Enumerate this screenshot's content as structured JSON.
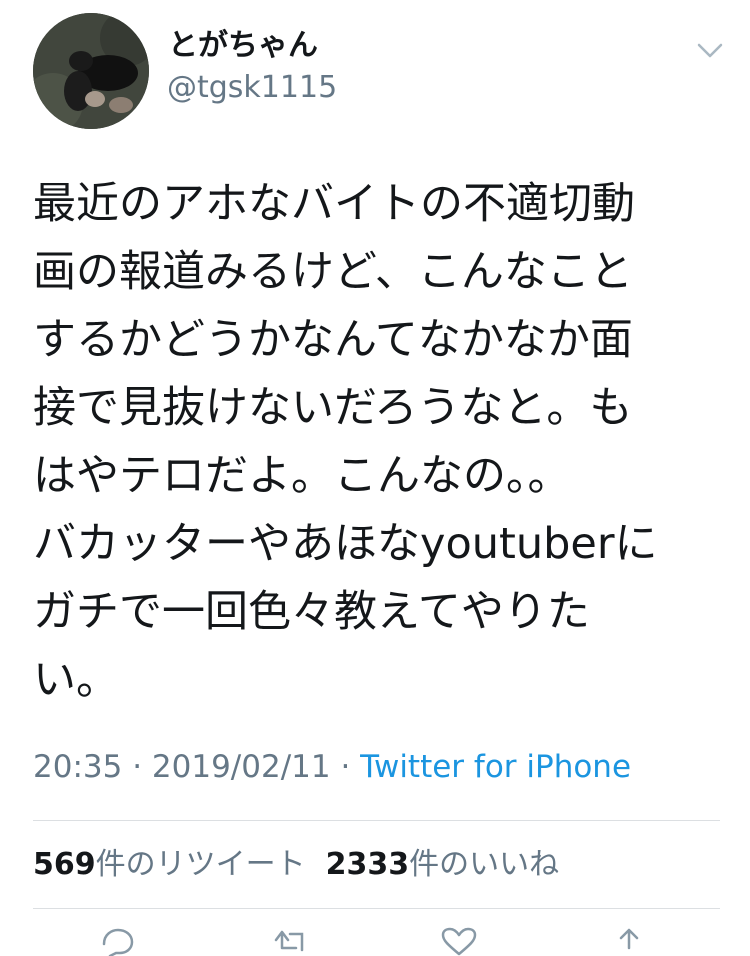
{
  "user": {
    "display_name": "とがちゃん",
    "handle": "@tgsk1115"
  },
  "tweet": {
    "lines": [
      "最近のアホなバイトの不適切動",
      "画の報道みるけど、こんなこと",
      "するかどうかなんてなかなか面",
      "接で見抜けないだろうなと。も",
      "はやテロだよ。こんなの。。",
      "バカッターやあほなyoutuberに",
      "ガチで一回色々教えてやりた",
      "い。"
    ]
  },
  "meta": {
    "time": "20:35",
    "separator1": " · ",
    "date": "2019/02/11",
    "separator2": " · ",
    "source": "Twitter for iPhone"
  },
  "stats": {
    "retweets_count": "569",
    "retweets_label": "件のリツイート",
    "likes_count": "2333",
    "likes_label": "件のいいね"
  },
  "icons": {
    "more": "chevron-down-icon",
    "reply": "reply-icon",
    "retweet": "retweet-icon",
    "like": "heart-icon",
    "share": "share-icon"
  },
  "colors": {
    "text": "#14171a",
    "secondary": "#657786",
    "link": "#1b95e0",
    "divider": "#dcdfe2"
  }
}
